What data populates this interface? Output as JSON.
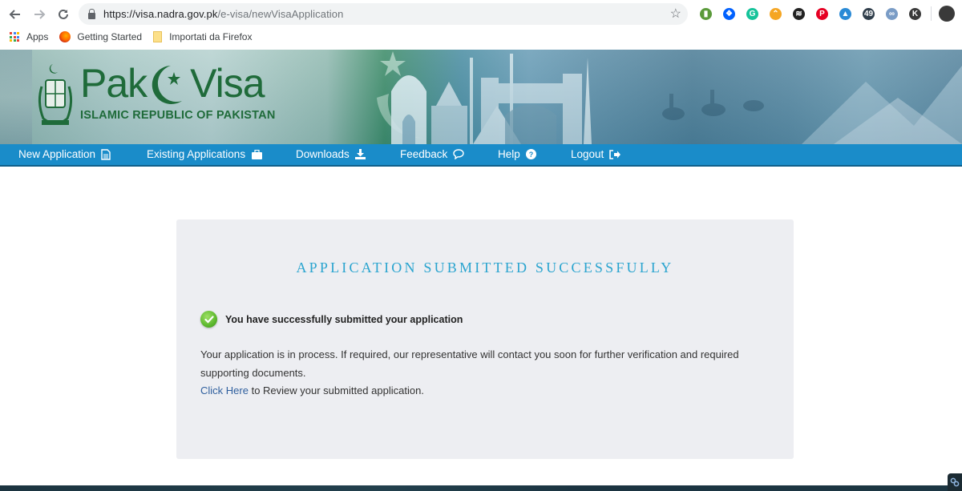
{
  "browser": {
    "url_host": "https://visa.nadra.gov.pk",
    "url_path": "/e-visa/newVisaApplication",
    "bookmarks": [
      {
        "label": "Apps",
        "icon": "apps-grid-icon"
      },
      {
        "label": "Getting Started",
        "icon": "firefox-icon"
      },
      {
        "label": "Importati da Firefox",
        "icon": "folder-icon"
      }
    ],
    "extensions": [
      {
        "name": "evernote-icon",
        "color": "#5a9a3a",
        "glyph": "▮"
      },
      {
        "name": "dropbox-icon",
        "color": "#0061fe",
        "glyph": "❖"
      },
      {
        "name": "grammarly-icon",
        "color": "#15c39a",
        "glyph": "G"
      },
      {
        "name": "arc-icon",
        "color": "#f5a623",
        "glyph": "⌃"
      },
      {
        "name": "buffer-icon",
        "color": "#222222",
        "glyph": "≋"
      },
      {
        "name": "pinterest-icon",
        "color": "#e60023",
        "glyph": "P"
      },
      {
        "name": "sail-icon",
        "color": "#2a8ad6",
        "glyph": "▲"
      },
      {
        "name": "counter-icon",
        "color": "#2f3d4a",
        "glyph": "49"
      },
      {
        "name": "link-icon",
        "color": "#7a9cc6",
        "glyph": "∞"
      },
      {
        "name": "k-icon",
        "color": "#3a3a3a",
        "glyph": "K"
      }
    ]
  },
  "banner": {
    "logo_left": "Pak",
    "logo_right": "Visa",
    "subtitle": "ISLAMIC REPUBLIC OF PAKISTAN"
  },
  "nav": {
    "items": [
      {
        "label": "New Application",
        "icon": "document-icon"
      },
      {
        "label": "Existing Applications",
        "icon": "briefcase-icon"
      },
      {
        "label": "Downloads",
        "icon": "download-icon"
      },
      {
        "label": "Feedback",
        "icon": "comment-icon"
      },
      {
        "label": "Help",
        "icon": "question-icon"
      },
      {
        "label": "Logout",
        "icon": "sign-out-icon"
      }
    ]
  },
  "content": {
    "title": "APPLICATION SUBMITTED SUCCESSFULLY",
    "success_message": "You have successfully submitted your application",
    "paragraph": "Your application is in process. If required, our representative will contact you soon for further verification and required supporting documents.",
    "review_link": "Click Here",
    "review_suffix": " to Review your submitted application."
  },
  "colors": {
    "nav_bg": "#1a8cc9",
    "title": "#2aa4cf",
    "link": "#2f5f9e",
    "logo_green": "#1f6b3a",
    "success_green": "#5cb82e"
  }
}
